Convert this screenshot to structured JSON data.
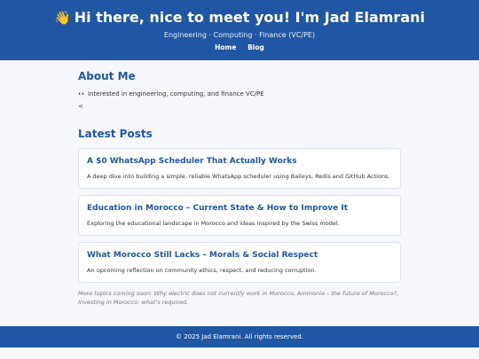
{
  "header": {
    "wave_emoji": "👋",
    "title": "Hi there, nice to meet you! I'm Jad Elamrani",
    "tagline": "Engineering · Computing · Finance (VC/PE)",
    "nav": [
      "Home",
      "Blog"
    ]
  },
  "about": {
    "heading": "About Me",
    "line": "👀 Interested in engineering, computing, and finance VC/PE",
    "extra": "<"
  },
  "posts": {
    "heading": "Latest Posts",
    "items": [
      {
        "title": "A $0 WhatsApp Scheduler That Actually Works",
        "description": "A deep dive into building a simple, reliable WhatsApp scheduler using Baileys, Redis and GitHub Actions."
      },
      {
        "title": "Education in Morocco – Current State & How to Improve It",
        "description": "Exploring the educational landscape in Morocco and ideas inspired by the Swiss model."
      },
      {
        "title": "What Morocco Still Lacks – Morals & Social Respect",
        "description": "An upcoming reflection on community ethics, respect, and reducing corruption."
      }
    ],
    "coming_soon": "More topics coming soon: Why electric does not currently work in Morocco, Ammonia – the future of Morocco?, Investing in Morocco: what's required."
  },
  "footer": {
    "text": "© 2025 Jad Elamrani. All rights reserved."
  },
  "colors": {
    "brand": "#1f57a5",
    "background": "#f5f7fb"
  }
}
